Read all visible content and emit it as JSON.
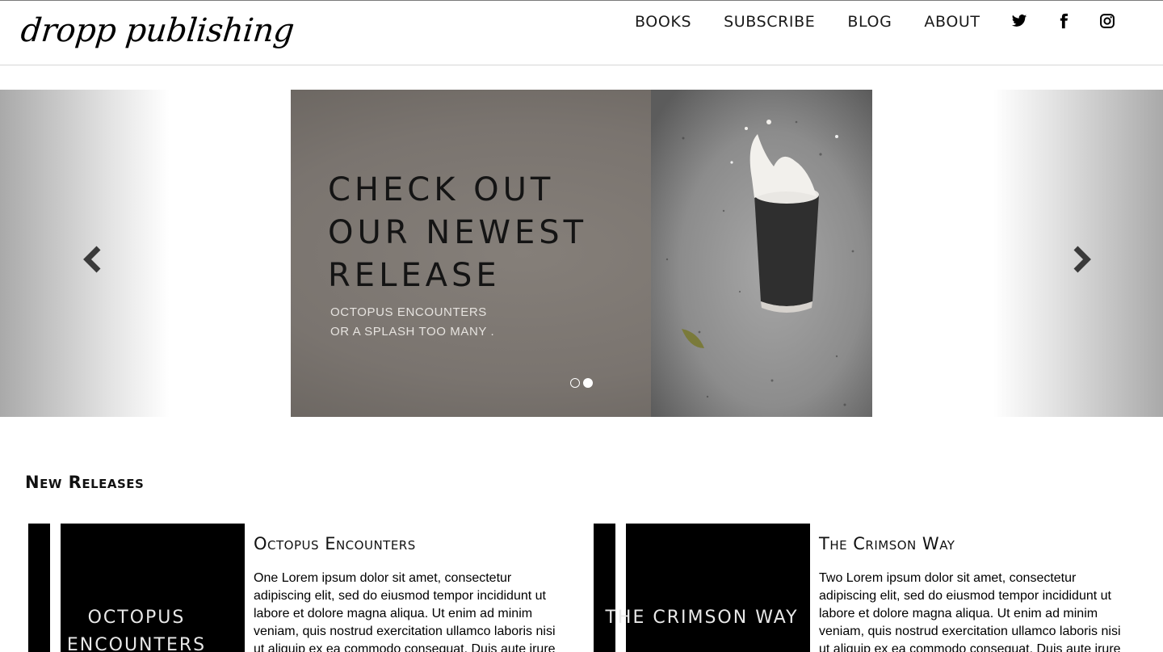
{
  "brand": {
    "logo": "dropp publishing"
  },
  "nav": {
    "items": [
      "BOOKS",
      "SUBSCRIBE",
      "BLOG",
      "ABOUT"
    ],
    "social": [
      "twitter-icon",
      "facebook-icon",
      "instagram-icon"
    ]
  },
  "carousel": {
    "headline": [
      "CHECK OUT",
      "OUR NEWEST",
      "RELEASE"
    ],
    "subtitle": [
      "OCTOPUS ENCOUNTERS",
      "OR A SPLASH TOO MANY ."
    ],
    "slide_count": 2,
    "active_slide": 2,
    "prev_icon": "chevron-left-icon",
    "next_icon": "chevron-right-icon"
  },
  "new_releases": {
    "heading": "New Releases",
    "books": [
      {
        "cover_lines": [
          "OCTOPUS",
          "ENCOUNTERS"
        ],
        "title": "Octopus Encounters",
        "description": "One Lorem ipsum dolor sit amet, consectetur adipiscing elit, sed do eiusmod tempor incididunt ut labore et dolore magna aliqua. Ut enim ad minim veniam, quis nostrud exercitation ullamco laboris nisi ut aliquip ex ea commodo consequat. Duis aute irure"
      },
      {
        "cover_lines": [
          "THE CRIMSON WAY"
        ],
        "title": "The Crimson Way",
        "description": "Two Lorem ipsum dolor sit amet, consectetur adipiscing elit, sed do eiusmod tempor incididunt ut labore et dolore magna aliqua. Ut enim ad minim veniam, quis nostrud exercitation ullamco laboris nisi ut aliquip ex ea commodo consequat. Duis aute irure"
      }
    ]
  }
}
